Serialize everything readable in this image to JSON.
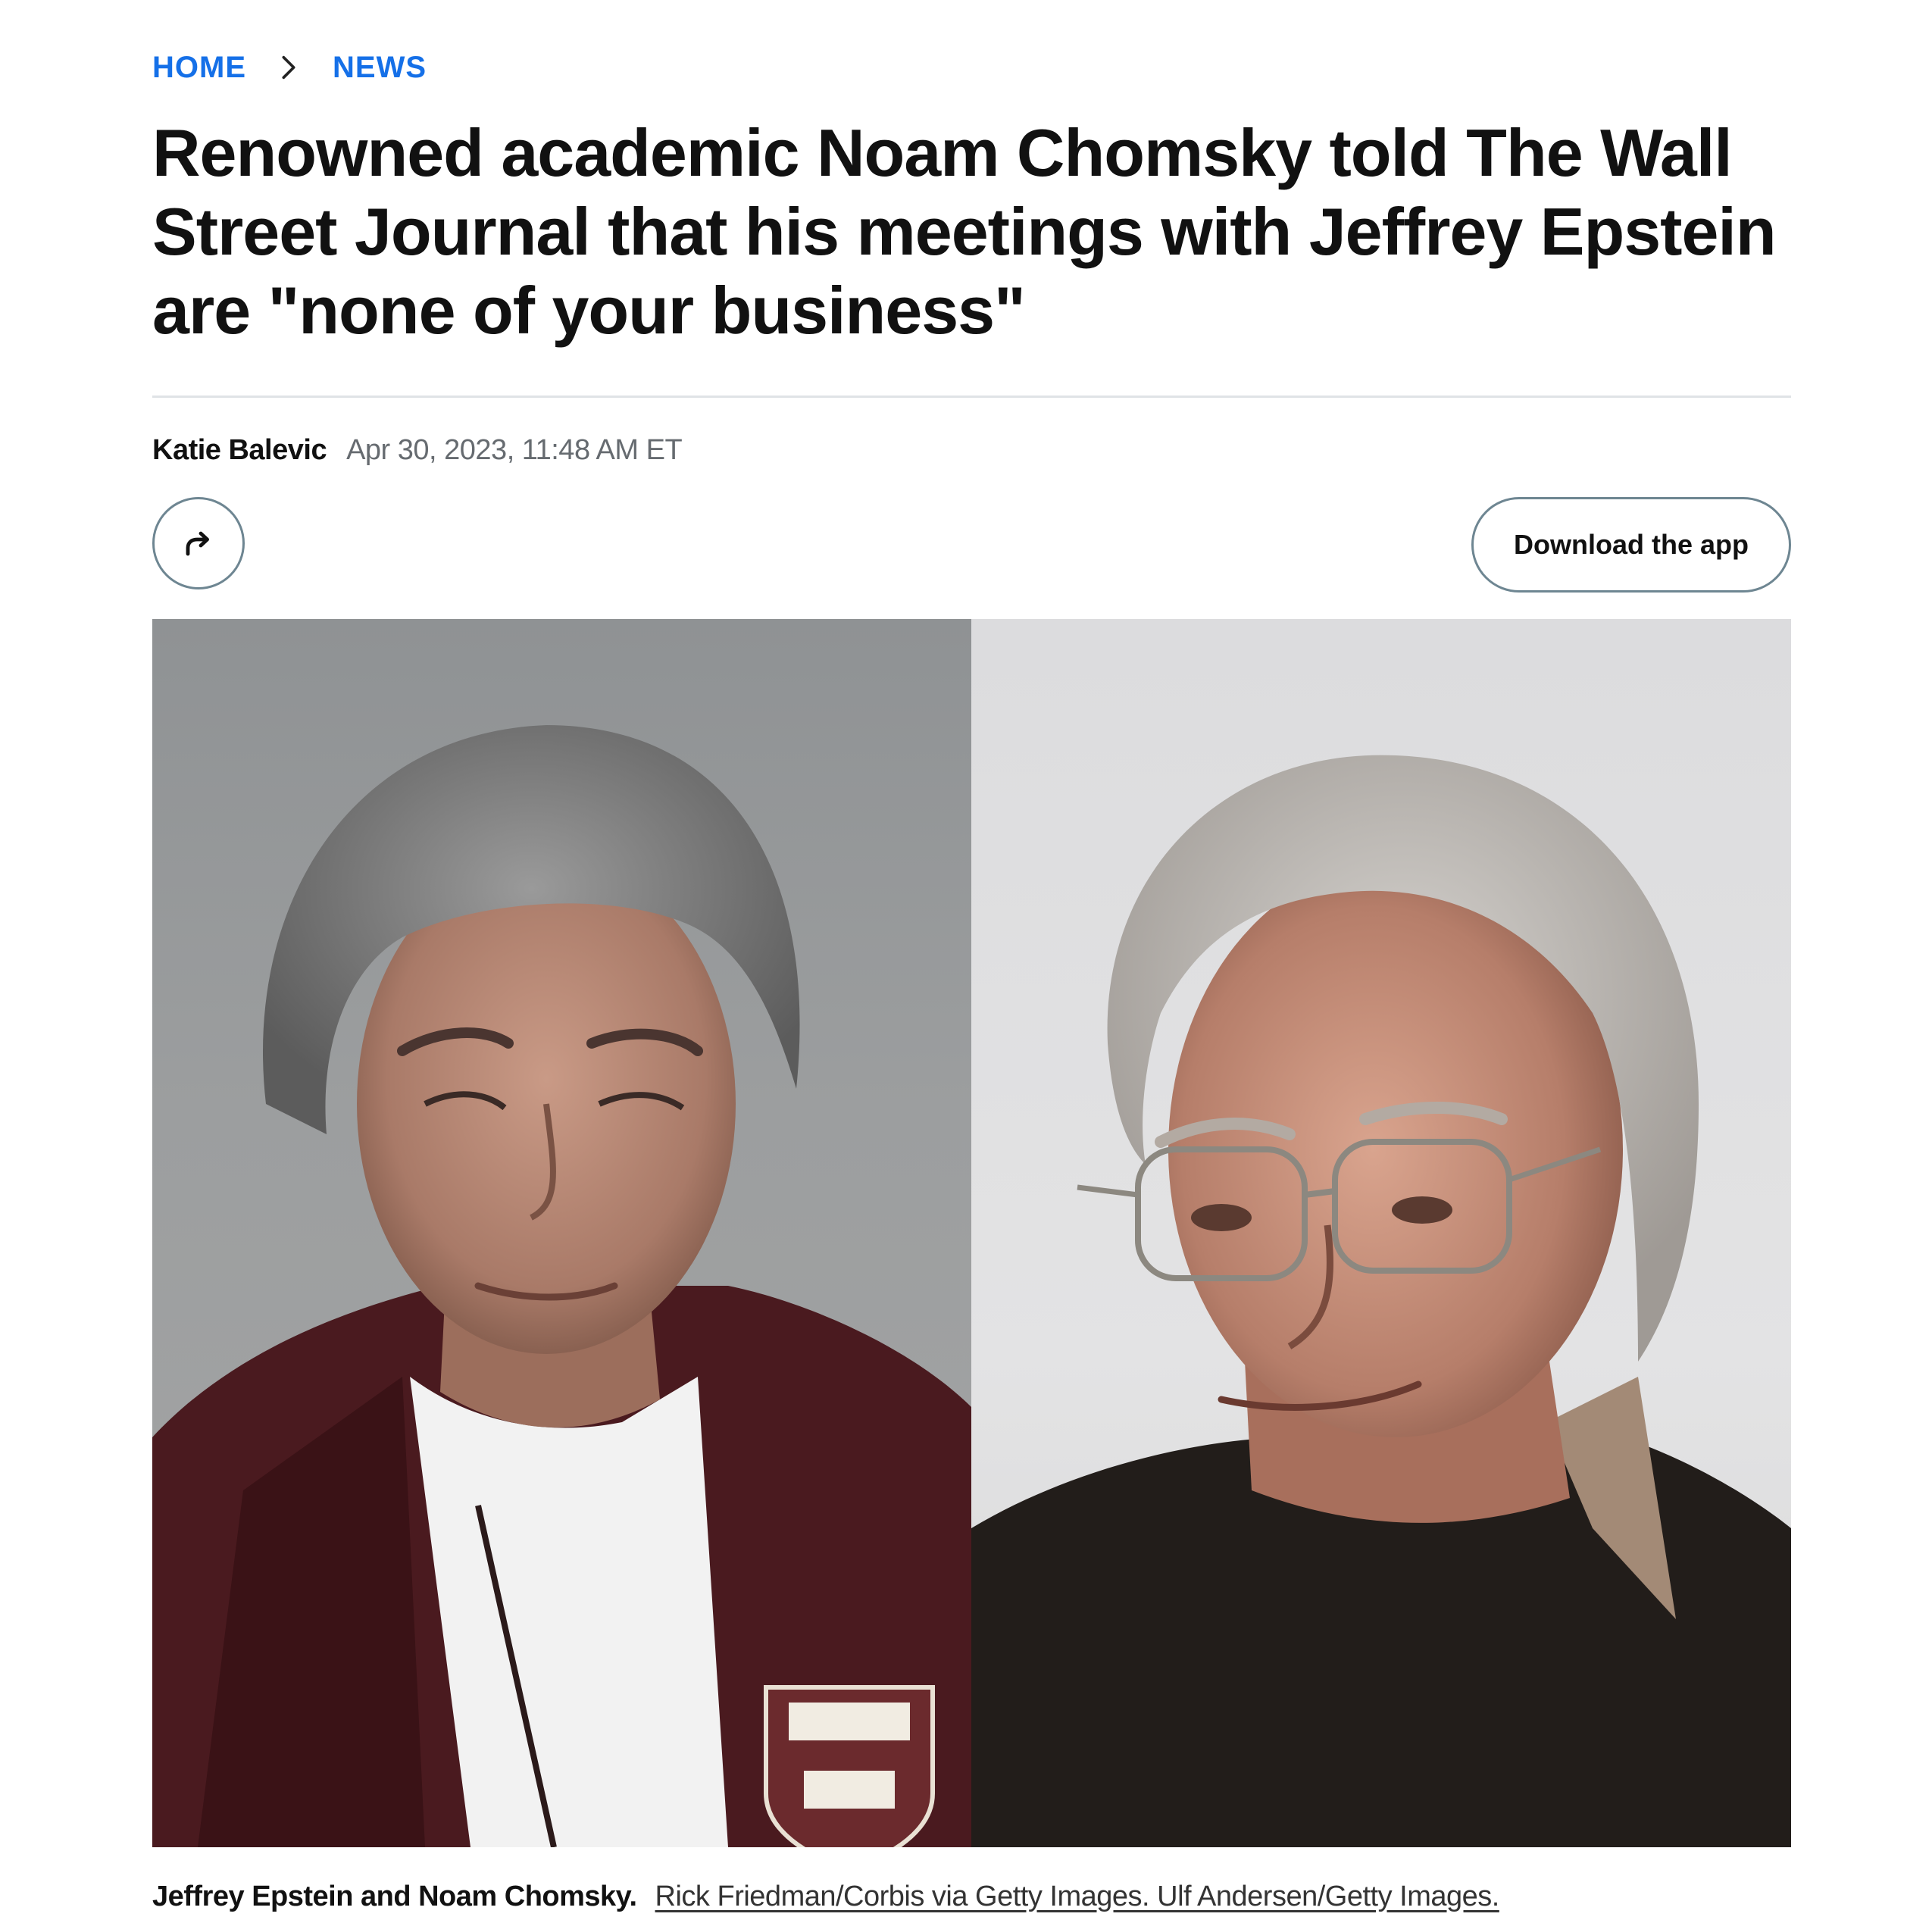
{
  "breadcrumb": {
    "home_label": "HOME",
    "news_label": "NEWS"
  },
  "article": {
    "headline": "Renowned academic Noam Chomsky told The Wall Street Journal that his meetings with Jeffrey Epstein are \"none of your business\"",
    "author": "Katie Balevic",
    "timestamp": "Apr 30, 2023, 11:48 AM ET"
  },
  "actions": {
    "share_icon": "share-arrow-icon",
    "download_label": "Download the app"
  },
  "hero_image": {
    "caption": "Jeffrey Epstein and Noam Chomsky.",
    "credit": "Rick Friedman/Corbis via Getty Images. Ulf Andersen/Getty Images."
  },
  "colors": {
    "breadcrumb_link": "#1570e8",
    "text_primary": "#111111",
    "text_muted": "#666b70",
    "button_border": "#6e8692",
    "divider": "#dfe3e6"
  }
}
